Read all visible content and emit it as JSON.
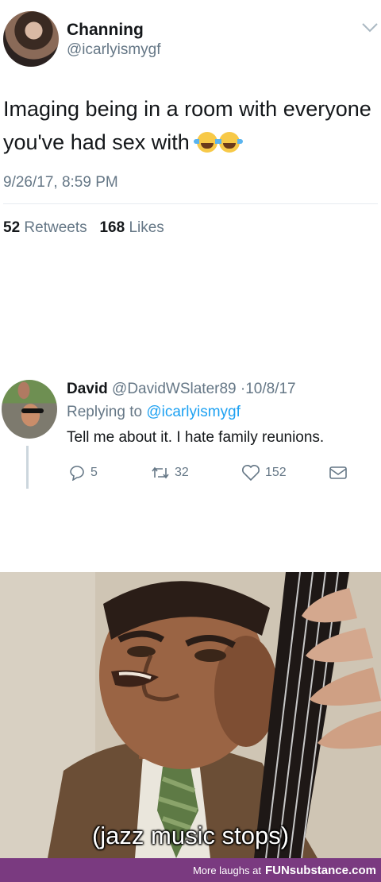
{
  "tweet1": {
    "name": "Channing",
    "handle": "@icarlyismygf",
    "text": "Imaging being in a room with everyone you've had sex with",
    "emoji": [
      "face-with-tears-of-joy",
      "face-with-tears-of-joy"
    ],
    "timestamp": "9/26/17, 8:59 PM",
    "retweets_count": "52",
    "retweets_label": "Retweets",
    "likes_count": "168",
    "likes_label": "Likes"
  },
  "tweet2": {
    "name": "David",
    "handle": "@DavidWSlater89",
    "separator": "·",
    "date": "10/8/17",
    "replying_prefix": "Replying to",
    "replying_to": "@icarlyismygf",
    "text": "Tell me about it. I hate family reunions.",
    "replies": "5",
    "retweets": "32",
    "likes": "152"
  },
  "meme": {
    "caption": "(jazz music stops)"
  },
  "footer": {
    "prefix": "More laughs at",
    "brand": "FUNsubstance.com",
    "bg_color": "#7a3a80"
  }
}
